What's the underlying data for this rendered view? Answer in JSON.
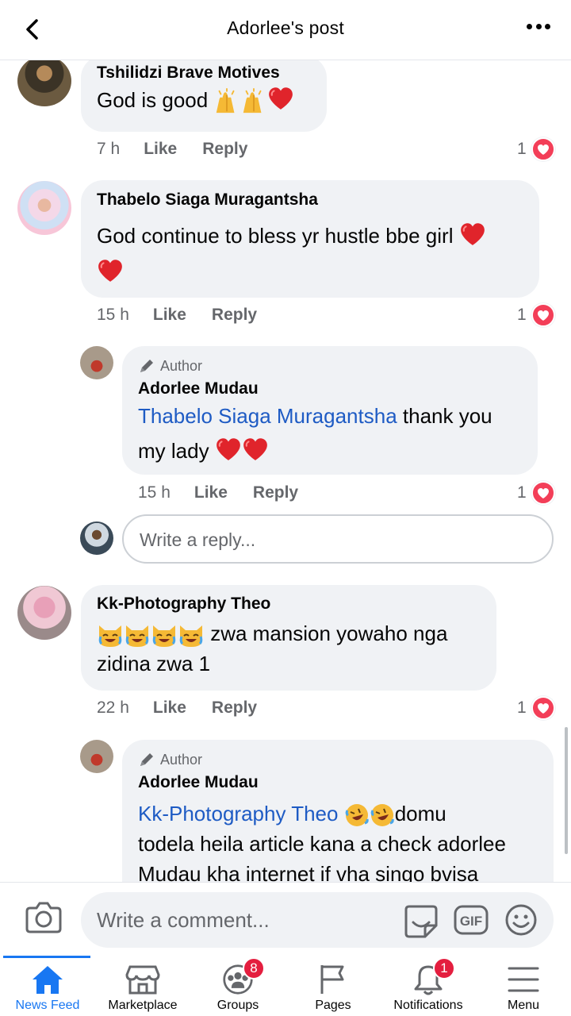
{
  "header": {
    "title": "Adorlee's post"
  },
  "comments": [
    {
      "name": "Tshilidzi Brave Motives",
      "text": "God is good",
      "time": "7 h",
      "like": "Like",
      "reply": "Reply",
      "reactions": "1"
    },
    {
      "name": "Thabelo Siaga Muragantsha",
      "text": "God continue to bless yr hustle bbe girl",
      "time": "15 h",
      "like": "Like",
      "reply": "Reply",
      "reactions": "1"
    },
    {
      "author_tag": "Author",
      "name": "Adorlee  Mudau",
      "mention": "Thabelo Siaga Muragantsha",
      "text": " thank you my lady",
      "time": "15 h",
      "like": "Like",
      "reply": "Reply",
      "reactions": "1"
    },
    {
      "name": "Kk-Photography Theo",
      "text_line1": " zwa mansion  yowaho nga",
      "text_line2": "zidina zwa 1",
      "time": "22 h",
      "like": "Like",
      "reply": "Reply",
      "reactions": "1"
    },
    {
      "author_tag": "Author",
      "name": "Adorlee  Mudau",
      "mention": "Kk-Photography Theo",
      "text_line1": "domu",
      "text_line2": "todela heila article kana a check adorlee",
      "text_line3": "Mudau kha internet if vha singo bvisa"
    }
  ],
  "reply_box": {
    "placeholder": "Write a reply..."
  },
  "composer": {
    "placeholder": "Write a comment..."
  },
  "nav": [
    {
      "label": "News Feed",
      "icon": "home-icon",
      "active": true
    },
    {
      "label": "Marketplace",
      "icon": "marketplace-icon"
    },
    {
      "label": "Groups",
      "icon": "groups-icon",
      "badge": "8"
    },
    {
      "label": "Pages",
      "icon": "pages-flag-icon"
    },
    {
      "label": "Notifications",
      "icon": "bell-icon",
      "badge": "1"
    },
    {
      "label": "Menu",
      "icon": "hamburger-icon"
    }
  ],
  "colors": {
    "accent": "#1877f2",
    "mention": "#1e5bc4",
    "heart": "#f33e58",
    "badge": "#e41e3f",
    "bubble": "#f0f2f5"
  }
}
